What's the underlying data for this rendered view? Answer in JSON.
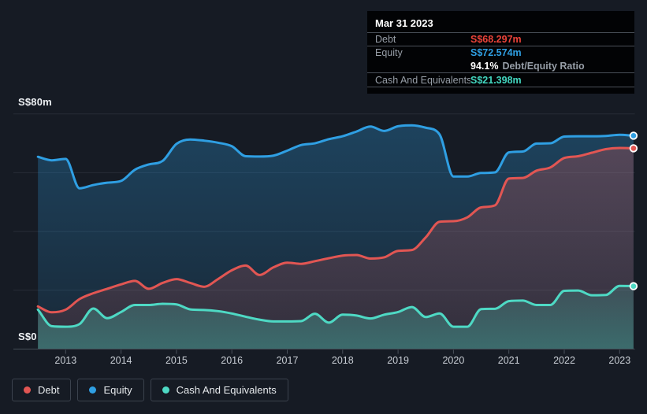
{
  "colors": {
    "background": "#161b24",
    "gridline": "#262d37",
    "axis_line": "#454d57",
    "tick": "#4a515b",
    "debt": "#e25653",
    "equity": "#2f9fe3",
    "cash": "#4ed9c4",
    "debt_value": "#ec4339",
    "equity_value": "#2f9fe3",
    "cash_value": "#43d7c0"
  },
  "tooltip": {
    "date": "Mar 31 2023",
    "debt": {
      "label": "Debt",
      "value": "S$68.297m"
    },
    "equity": {
      "label": "Equity",
      "value": "S$72.574m"
    },
    "ratio": {
      "pct": "94.1%",
      "label": "Debt/Equity Ratio"
    },
    "cash": {
      "label": "Cash And Equivalents",
      "value": "S$21.398m"
    }
  },
  "y_axis": {
    "top_label": "S$80m",
    "bottom_label": "S$0"
  },
  "x_axis": {
    "labels": [
      "2013",
      "2014",
      "2015",
      "2016",
      "2017",
      "2018",
      "2019",
      "2020",
      "2021",
      "2022",
      "2023"
    ]
  },
  "legend": {
    "items": [
      {
        "label": "Debt",
        "color": "#e25653"
      },
      {
        "label": "Equity",
        "color": "#2f9fe3"
      },
      {
        "label": "Cash And Equivalents",
        "color": "#4ed9c4"
      }
    ]
  },
  "chart_data": {
    "type": "area",
    "title": "Debt to Equity History and Analysis",
    "x_unit": "year",
    "y_unit": "S$ millions",
    "ylim": [
      0,
      80
    ],
    "grid_values": [
      0,
      20,
      40,
      60,
      80
    ],
    "xticks": [
      2013,
      2014,
      2015,
      2016,
      2017,
      2018,
      2019,
      2020,
      2021,
      2022,
      2023
    ],
    "latest": {
      "date": "Mar 31 2023",
      "debt": 68.297,
      "equity": 72.574,
      "cash": 21.398,
      "debt_equity_ratio_pct": 94.1
    },
    "x": [
      2012.5,
      2012.75,
      2013,
      2013.25,
      2013.5,
      2013.75,
      2014,
      2014.25,
      2014.5,
      2014.75,
      2015,
      2015.25,
      2015.5,
      2015.75,
      2016,
      2016.25,
      2016.5,
      2016.75,
      2017,
      2017.25,
      2017.5,
      2017.75,
      2018,
      2018.25,
      2018.5,
      2018.75,
      2019,
      2019.25,
      2019.5,
      2019.75,
      2020,
      2020.25,
      2020.5,
      2020.75,
      2021,
      2021.25,
      2021.5,
      2021.75,
      2022,
      2022.25,
      2022.5,
      2022.75,
      2023,
      2023.25
    ],
    "series": [
      {
        "name": "Debt",
        "color": "#e25653",
        "values": [
          14.5,
          12.5,
          13.4,
          17.0,
          19.0,
          20.5,
          22.0,
          23.2,
          20.5,
          22.5,
          23.8,
          22.5,
          21.2,
          23.8,
          26.8,
          28.4,
          25.2,
          27.8,
          29.4,
          29.0,
          29.9,
          30.9,
          31.8,
          32.0,
          30.8,
          31.2,
          33.4,
          33.7,
          38.0,
          43.3,
          43.5,
          44.8,
          48.2,
          48.9,
          58.0,
          58.2,
          60.7,
          61.8,
          65.0,
          65.6,
          66.8,
          68.0,
          68.4,
          68.297
        ]
      },
      {
        "name": "Equity",
        "color": "#2f9fe3",
        "values": [
          65.4,
          64.2,
          64.7,
          54.7,
          55.8,
          56.6,
          57.2,
          61.0,
          62.8,
          64.0,
          69.8,
          71.3,
          70.9,
          70.2,
          69.0,
          65.6,
          65.5,
          65.8,
          67.5,
          69.4,
          70.0,
          71.4,
          72.4,
          74.0,
          75.7,
          74.2,
          75.8,
          76.1,
          75.3,
          73.0,
          58.7,
          58.7,
          59.9,
          60.1,
          66.9,
          67.2,
          69.9,
          70.0,
          72.3,
          72.4,
          72.4,
          72.5,
          72.9,
          72.574
        ]
      },
      {
        "name": "Cash And Equivalents",
        "color": "#4ed9c4",
        "values": [
          13.4,
          7.8,
          7.6,
          8.5,
          13.8,
          10.5,
          12.6,
          15.0,
          15.0,
          15.4,
          15.2,
          13.5,
          13.3,
          12.9,
          12.1,
          11.0,
          10.0,
          9.4,
          9.4,
          9.5,
          12.0,
          9.0,
          11.7,
          11.4,
          10.4,
          11.7,
          12.6,
          14.3,
          10.9,
          12.1,
          7.6,
          7.6,
          13.6,
          13.7,
          16.3,
          16.5,
          15.0,
          15.0,
          19.8,
          19.9,
          18.3,
          18.4,
          21.5,
          21.398
        ]
      }
    ]
  }
}
